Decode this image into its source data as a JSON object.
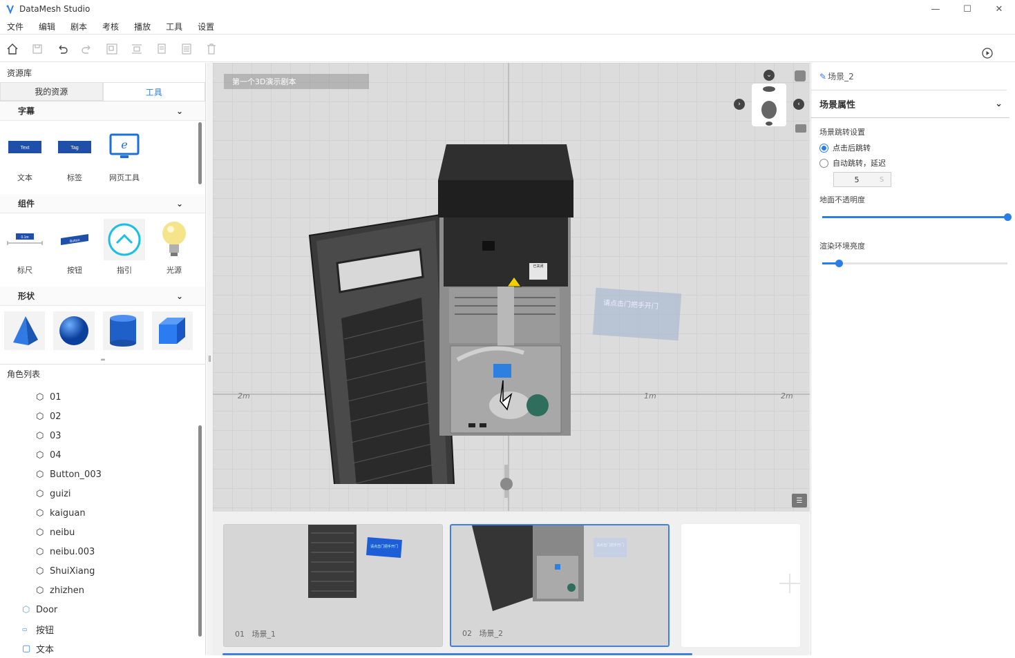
{
  "window": {
    "title": "DataMesh Studio",
    "controls": [
      "—",
      "☐",
      "✕"
    ]
  },
  "menu": [
    "文件",
    "编辑",
    "剧本",
    "考核",
    "播放",
    "工具",
    "设置"
  ],
  "toolbar": {
    "icons": [
      "home-icon",
      "save-icon",
      "undo-icon",
      "redo-icon",
      "group-icon",
      "align-icon",
      "copy-icon",
      "list-icon",
      "delete-icon",
      "play-icon"
    ]
  },
  "left": {
    "header": "资源库",
    "tabs": [
      "我的资源",
      "工具"
    ],
    "active_tab": "工具",
    "groups": {
      "subtitle": {
        "title": "字幕",
        "items": [
          {
            "label": "文本",
            "glyph": "Text"
          },
          {
            "label": "标签",
            "glyph": "Tag"
          },
          {
            "label": "网页工具"
          }
        ]
      },
      "widget": {
        "title": "组件",
        "items": [
          {
            "label": "标尺",
            "glyph": "0.1m"
          },
          {
            "label": "按钮",
            "glyph": "Button"
          },
          {
            "label": "指引"
          },
          {
            "label": "光源"
          }
        ]
      },
      "shape": {
        "title": "形状"
      }
    },
    "roles_header": "角色列表",
    "roles": [
      "01",
      "02",
      "03",
      "04",
      "Button_003",
      "guizi",
      "kaiguan",
      "neibu",
      "neibu.003",
      "ShuiXiang",
      "zhizhen"
    ],
    "roles_top": [
      {
        "label": "Door",
        "icon": "cube-outline-icon"
      },
      {
        "label": "按钮",
        "icon": "button-icon"
      },
      {
        "label": "文本",
        "icon": "text-icon"
      }
    ]
  },
  "viewport": {
    "title": "第一个3D演示剧本",
    "scale_labels": [
      "2m",
      "1m",
      "2m"
    ],
    "sign_text": "请点击门把手开门",
    "cabinet_label": "已关闭"
  },
  "timeline": {
    "scenes": [
      {
        "num": "01",
        "name": "场景_1",
        "sign": "请点击门把手开门"
      },
      {
        "num": "02",
        "name": "场景_2",
        "sign": "请点击门把手开门"
      }
    ]
  },
  "right": {
    "scene_name": "场景_2",
    "section": "场景属性",
    "jump_label": "场景跳转设置",
    "radio_click": "点击后跳转",
    "radio_auto": "自动跳转，延迟",
    "delay_value": "5",
    "delay_unit": "S",
    "opacity_label": "地面不透明度",
    "opacity_value": 1.0,
    "brightness_label": "渲染环境亮度",
    "brightness_value": 0.09
  }
}
